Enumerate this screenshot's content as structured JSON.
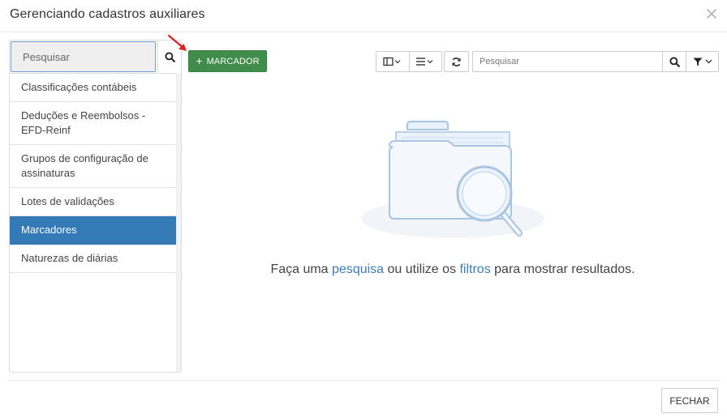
{
  "dialog": {
    "title": "Gerenciando cadastros auxiliares",
    "close_icon": "close-icon"
  },
  "sidebar": {
    "search": {
      "placeholder": "Pesquisar",
      "value": ""
    },
    "items": [
      {
        "label": "Classificações contábeis",
        "active": false
      },
      {
        "label": "Deduções e Reembolsos - EFD-Reinf",
        "active": false
      },
      {
        "label": "Grupos de configuração de assinaturas",
        "active": false
      },
      {
        "label": "Lotes de validações",
        "active": false
      },
      {
        "label": "Marcadores",
        "active": true
      },
      {
        "label": "Naturezas de diárias",
        "active": false
      }
    ]
  },
  "toolbar": {
    "add_label": "MARCADOR",
    "add_icon": "plus-icon",
    "search": {
      "placeholder": "Pesquisar",
      "value": ""
    },
    "icons": [
      "columns-icon",
      "list-icon",
      "refresh-icon",
      "search-icon",
      "filter-icon"
    ]
  },
  "empty_state": {
    "prefix": "Faça uma ",
    "link_search": "pesquisa",
    "middle": " ou utilize os ",
    "link_filters": "filtros",
    "suffix": " para mostrar resultados."
  },
  "footer": {
    "close_label": "FECHAR"
  },
  "colors": {
    "accent": "#337ab7",
    "add_button": "#3f8c4b",
    "link": "#3e7cb5",
    "annotation_arrow": "#e02020"
  }
}
